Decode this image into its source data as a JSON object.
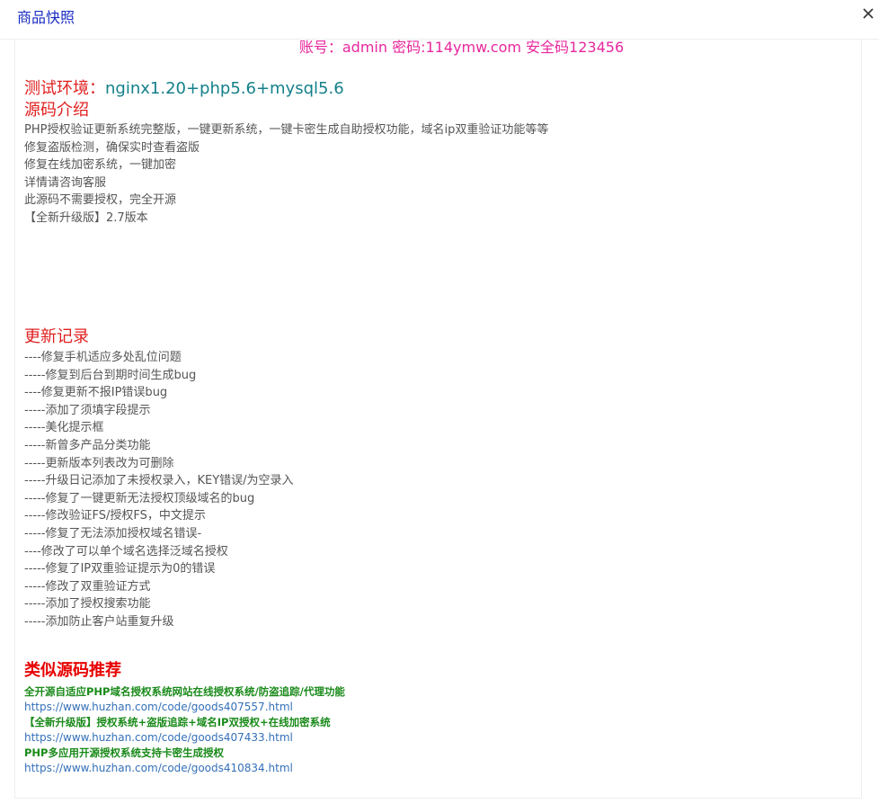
{
  "dialog": {
    "title": "商品快照",
    "close_label": "×"
  },
  "credentials": "账号：admin 密码:114ymw.com  安全码123456",
  "environment": {
    "label": "测试环境：",
    "value": "nginx1.20+php5.6+mysql5.6"
  },
  "intro": {
    "title": "源码介绍",
    "lines": [
      "PHP授权验证更新系统完整版，一键更新系统，一键卡密生成自助授权功能，域名ip双重验证功能等等",
      "修复盗版检测，确保实时查看盗版",
      "修复在线加密系统，一键加密",
      "详情请咨询客服",
      "此源码不需要授权，完全开源",
      "【全新升级版】2.7版本"
    ]
  },
  "updates": {
    "title": "更新记录",
    "items": [
      "----修复手机适应多处乱位问题",
      "-----修复到后台到期时间生成bug",
      "----修复更新不报IP错误bug",
      "-----添加了须填字段提示",
      "-----美化提示框",
      "-----新曾多产品分类功能",
      "-----更新版本列表改为可删除",
      "-----升级日记添加了未授权录入，KEY错误/为空录入",
      "-----修复了一键更新无法授权顶级域名的bug",
      "-----修改验证FS/授权FS，中文提示",
      "-----修复了无法添加授权域名错误-",
      "----修改了可以单个域名选择泛域名授权",
      "-----修复了IP双重验证提示为0的错误",
      "-----修改了双重验证方式",
      "-----添加了授权搜索功能",
      "-----添加防止客户站重复升级"
    ]
  },
  "recommendations": {
    "title": "类似源码推荐",
    "items": [
      {
        "name": "全开源自适应PHP域名授权系统网站在线授权系统/防盗追踪/代理功能",
        "url": "https://www.huzhan.com/code/goods407557.html"
      },
      {
        "name": "【全新升级版】授权系统+盗版追踪+域名IP双授权+在线加密系统",
        "url": "https://www.huzhan.com/code/goods407433.html"
      },
      {
        "name": "PHP多应用开源授权系统支持卡密生成授权",
        "url": "https://www.huzhan.com/code/goods410834.html"
      }
    ]
  }
}
